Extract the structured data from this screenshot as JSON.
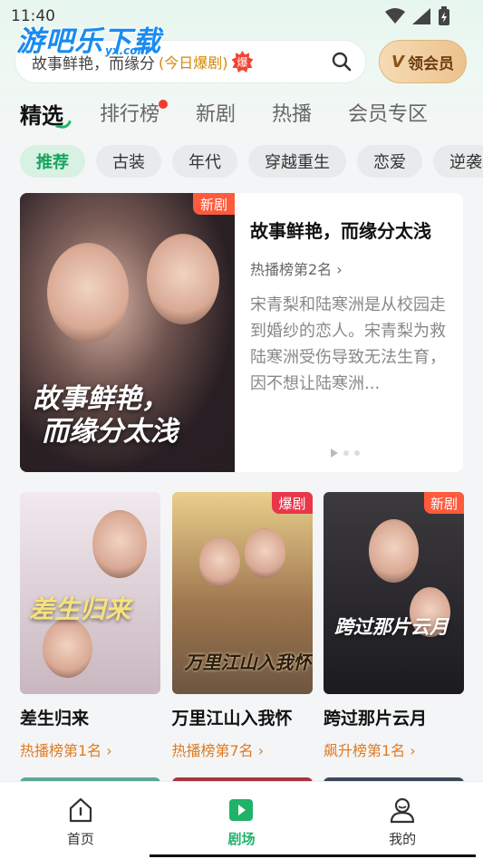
{
  "status_bar": {
    "time": "11:40"
  },
  "watermark": {
    "text": "游吧乐下载",
    "sub": "yx.com"
  },
  "search": {
    "text": "故事鲜艳，而缘分",
    "tag": "(今日爆剧)",
    "hot_badge": "爆",
    "icon": "search-icon"
  },
  "vip_button": {
    "label": "领会员",
    "icon_letter": "V"
  },
  "tabs": [
    {
      "label": "精选",
      "active": true
    },
    {
      "label": "排行榜",
      "has_dot": true
    },
    {
      "label": "新剧"
    },
    {
      "label": "热播"
    },
    {
      "label": "会员专区"
    }
  ],
  "chips": [
    {
      "label": "推荐",
      "active": true
    },
    {
      "label": "古装"
    },
    {
      "label": "年代"
    },
    {
      "label": "穿越重生"
    },
    {
      "label": "恋爱"
    },
    {
      "label": "逆袭"
    }
  ],
  "featured": {
    "tag": "新剧",
    "title": "故事鲜艳，而缘分太浅",
    "rank": "热播榜第2名 ›",
    "description": "宋青梨和陆寒洲是从校园走到婚纱的恋人。宋青梨为救陆寒洲受伤导致无法生育，因不想让陆寒洲...",
    "poster_art": [
      "故事鲜艳，",
      "而缘分太浅"
    ]
  },
  "grid": [
    {
      "title": "差生归来",
      "rank": "热播榜第1名 ›",
      "poster_art": "差生归来",
      "tag": "",
      "colors": [
        "#f1e9ee",
        "#c9b7bf"
      ]
    },
    {
      "title": "万里江山入我怀",
      "rank": "热播榜第7名 ›",
      "poster_art": "万里江山入我怀",
      "tag": "爆剧",
      "tag_color": "#e8374a",
      "colors": [
        "#e9cf8c",
        "#6d5540"
      ]
    },
    {
      "title": "跨过那片云月",
      "rank": "飙升榜第1名 ›",
      "poster_art": "跨过那片云月",
      "tag": "新剧",
      "tag_color": "#ff5a3c",
      "colors": [
        "#3d3a3e",
        "#1c1b1f"
      ]
    }
  ],
  "bottom_nav": [
    {
      "label": "首页",
      "icon": "home-icon"
    },
    {
      "label": "剧场",
      "icon": "theater-play-icon",
      "active": true
    },
    {
      "label": "我的",
      "icon": "profile-icon"
    }
  ],
  "colors": {
    "accent_green": "#1fb36a",
    "rank_orange": "#e07a1f",
    "tag_red": "#ff5a3c"
  }
}
